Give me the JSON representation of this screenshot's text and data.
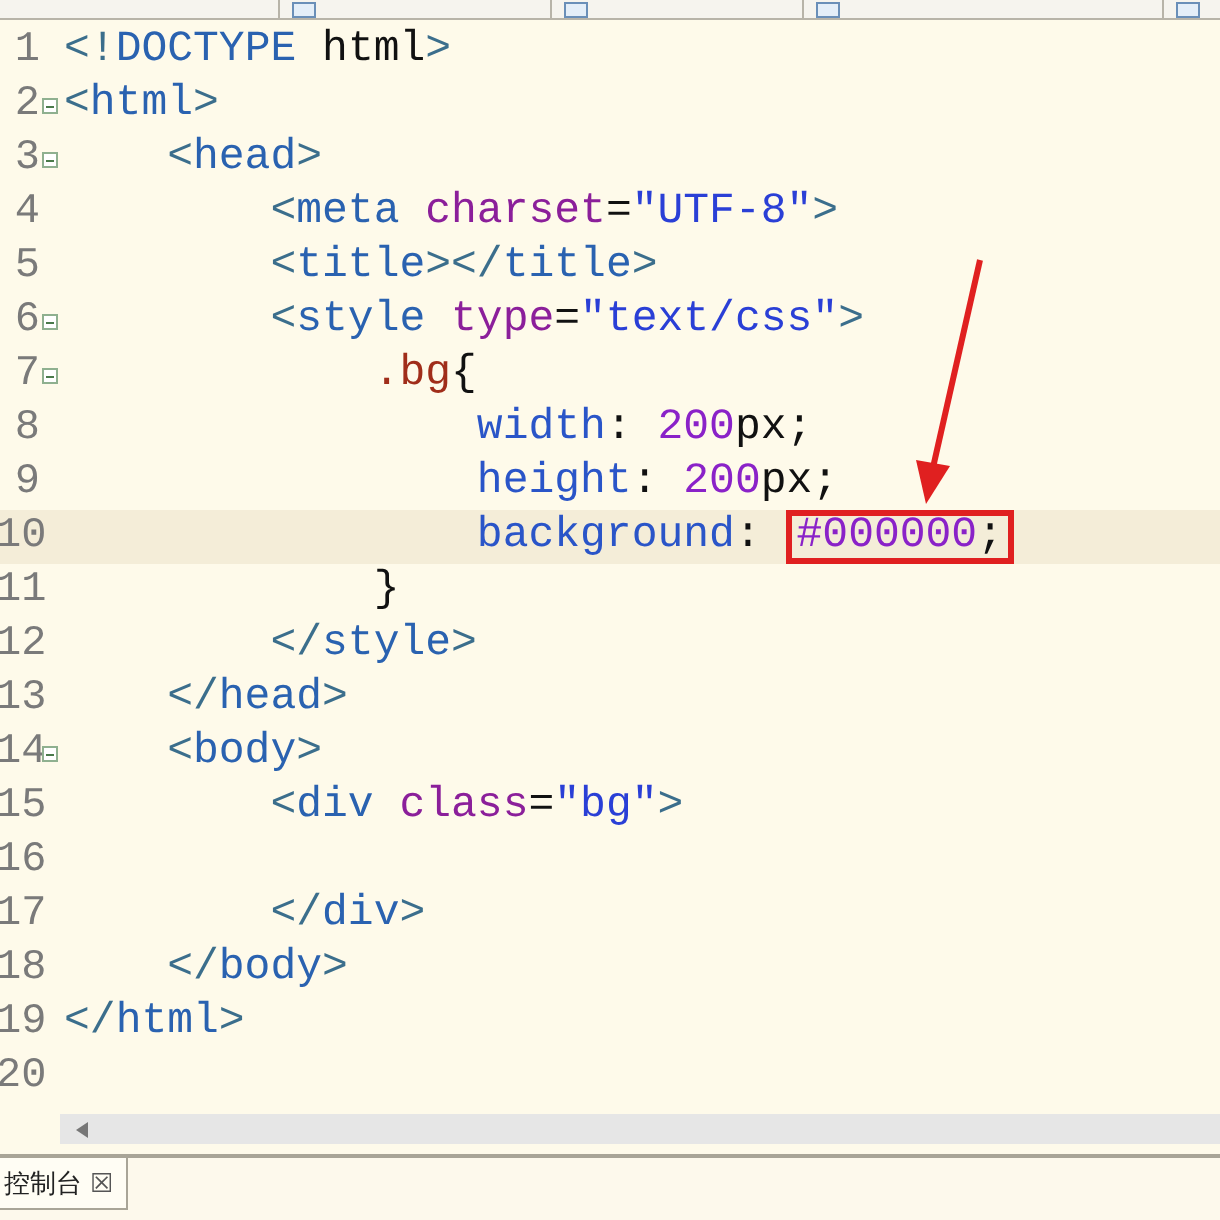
{
  "editor": {
    "lines": [
      {
        "number": "1",
        "foldable": false,
        "current": false,
        "tokens": [
          {
            "kind": "punct",
            "text": "<!"
          },
          {
            "kind": "tag",
            "text": "DOCTYPE"
          },
          {
            "kind": "plain",
            "text": " html"
          },
          {
            "kind": "punct",
            "text": ">"
          }
        ]
      },
      {
        "number": "2",
        "foldable": true,
        "current": false,
        "tokens": [
          {
            "kind": "punct",
            "text": "<"
          },
          {
            "kind": "tag",
            "text": "html"
          },
          {
            "kind": "punct",
            "text": ">"
          }
        ],
        "children": [
          {
            "number": "3",
            "foldable": true,
            "current": false,
            "tokens": [
              {
                "kind": "punct",
                "text": "<"
              },
              {
                "kind": "tag",
                "text": "head"
              },
              {
                "kind": "punct",
                "text": ">"
              }
            ],
            "children": [
              {
                "number": "4",
                "foldable": false,
                "current": false,
                "tokens": [
                  {
                    "kind": "punct",
                    "text": "<"
                  },
                  {
                    "kind": "tag",
                    "text": "meta"
                  },
                  {
                    "kind": "attr",
                    "text": "charset"
                  },
                  {
                    "kind": "plain",
                    "text": "="
                  },
                  {
                    "kind": "string",
                    "text": "\"UTF-8\""
                  },
                  {
                    "kind": "punct",
                    "text": ">"
                  }
                ]
              },
              {
                "number": "5",
                "foldable": false,
                "current": false,
                "tokens": [
                  {
                    "kind": "punct",
                    "text": "<"
                  },
                  {
                    "kind": "tag",
                    "text": "title"
                  },
                  {
                    "kind": "punct",
                    "text": "></"
                  },
                  {
                    "kind": "tag",
                    "text": "title"
                  },
                  {
                    "kind": "punct",
                    "text": ">"
                  }
                ]
              },
              {
                "number": "6",
                "foldable": true,
                "current": false,
                "tokens": [
                  {
                    "kind": "punct",
                    "text": "<"
                  },
                  {
                    "kind": "tag",
                    "text": "style"
                  },
                  {
                    "kind": "attr",
                    "text": "type"
                  },
                  {
                    "kind": "plain",
                    "text": "="
                  },
                  {
                    "kind": "string",
                    "text": "\"text/css\""
                  },
                  {
                    "kind": "punct",
                    "text": ">"
                  }
                ],
                "children": [
                  {
                    "number": "7",
                    "foldable": true,
                    "current": false,
                    "tokens": [
                      {
                        "kind": "selector",
                        "text": ".bg"
                      },
                      {
                        "kind": "plain",
                        "text": "{"
                      }
                    ],
                    "children": [
                      {
                        "number": "8",
                        "foldable": false,
                        "current": false,
                        "tokens": [
                          {
                            "kind": "property",
                            "text": "width"
                          },
                          {
                            "kind": "plain",
                            "text": ": "
                          },
                          {
                            "kind": "number",
                            "text": "200"
                          },
                          {
                            "kind": "plain",
                            "text": "px;"
                          }
                        ]
                      },
                      {
                        "number": "9",
                        "foldable": false,
                        "current": false,
                        "tokens": [
                          {
                            "kind": "property",
                            "text": "height"
                          },
                          {
                            "kind": "plain",
                            "text": ": "
                          },
                          {
                            "kind": "number",
                            "text": "200"
                          },
                          {
                            "kind": "plain",
                            "text": "px;"
                          }
                        ]
                      },
                      {
                        "number": "10",
                        "foldable": false,
                        "current": true,
                        "tokens": [
                          {
                            "kind": "property",
                            "text": "background"
                          },
                          {
                            "kind": "plain",
                            "text": ": "
                          },
                          {
                            "kind": "annotated",
                            "tokens": [
                              {
                                "kind": "number",
                                "text": "#000000"
                              },
                              {
                                "kind": "plain",
                                "text": ";"
                              }
                            ]
                          }
                        ]
                      }
                    ]
                  },
                  {
                    "number": "11",
                    "foldable": false,
                    "current": false,
                    "tokens": [
                      {
                        "kind": "plain",
                        "text": "}"
                      }
                    ]
                  }
                ]
              },
              {
                "number": "12",
                "foldable": false,
                "current": false,
                "tokens": [
                  {
                    "kind": "punct",
                    "text": "</"
                  },
                  {
                    "kind": "tag",
                    "text": "style"
                  },
                  {
                    "kind": "punct",
                    "text": ">"
                  }
                ]
              }
            ]
          },
          {
            "number": "13",
            "foldable": false,
            "current": false,
            "tokens": [
              {
                "kind": "punct",
                "text": "</"
              },
              {
                "kind": "tag",
                "text": "head"
              },
              {
                "kind": "punct",
                "text": ">"
              }
            ]
          },
          {
            "number": "14",
            "foldable": true,
            "current": false,
            "tokens": [
              {
                "kind": "punct",
                "text": "<"
              },
              {
                "kind": "tag",
                "text": "body"
              },
              {
                "kind": "punct",
                "text": ">"
              }
            ],
            "children": [
              {
                "number": "15",
                "foldable": false,
                "current": false,
                "tokens": [
                  {
                    "kind": "punct",
                    "text": "<"
                  },
                  {
                    "kind": "tag",
                    "text": "div"
                  },
                  {
                    "kind": "attr",
                    "text": "class"
                  },
                  {
                    "kind": "plain",
                    "text": "="
                  },
                  {
                    "kind": "string",
                    "text": "\"bg\""
                  },
                  {
                    "kind": "punct",
                    "text": ">"
                  }
                ]
              },
              {
                "number": "16",
                "foldable": false,
                "current": false
              },
              {
                "number": "17",
                "foldable": false,
                "current": false,
                "tokens": [
                  {
                    "kind": "punct",
                    "text": "</"
                  },
                  {
                    "kind": "tag",
                    "text": "div"
                  },
                  {
                    "kind": "punct",
                    "text": ">"
                  }
                ]
              }
            ]
          },
          {
            "number": "18",
            "foldable": false,
            "current": false,
            "tokens": [
              {
                "kind": "punct",
                "text": "</"
              },
              {
                "kind": "tag",
                "text": "body"
              },
              {
                "kind": "punct",
                "text": ">"
              }
            ]
          }
        ]
      },
      {
        "number": "19",
        "foldable": false,
        "current": false,
        "tokens": [
          {
            "kind": "punct",
            "text": "</"
          },
          {
            "kind": "tag",
            "text": "html"
          },
          {
            "kind": "punct",
            "text": ">"
          }
        ]
      },
      {
        "number": "20",
        "foldable": false,
        "current": false
      }
    ]
  },
  "console_tab": {
    "label": "控制台",
    "close": "☒"
  }
}
